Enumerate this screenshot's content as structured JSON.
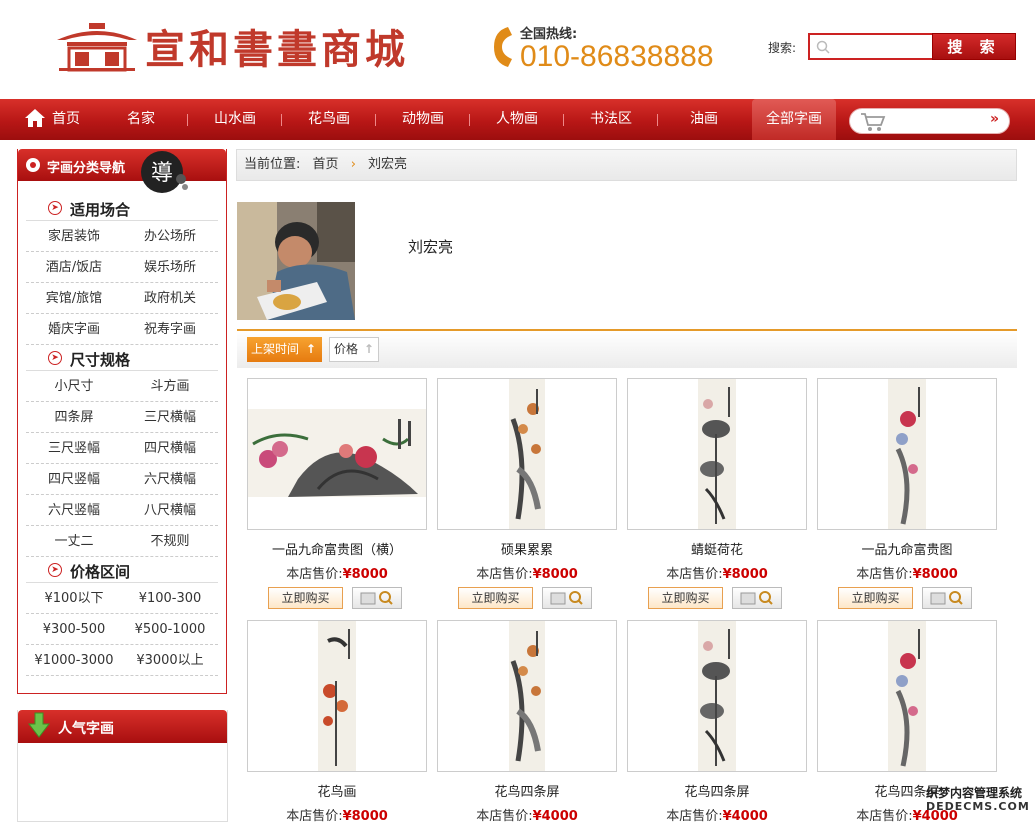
{
  "header": {
    "logo_text": "宣和書畫商城",
    "hotline_label": "全国热线:",
    "hotline_number": "010-86838888",
    "search_label": "搜索:",
    "search_placeholder": "",
    "search_button": "搜 索"
  },
  "nav": {
    "items": [
      "首页",
      "名家",
      "山水画",
      "花鸟画",
      "动物画",
      "人物画",
      "书法区",
      "油画",
      "全部字画"
    ],
    "active_index": 8
  },
  "sidebar": {
    "title": "字画分类导航",
    "badge": "導",
    "groups": [
      {
        "title": "适用场合",
        "items": [
          "家居装饰",
          "办公场所",
          "酒店/饭店",
          "娱乐场所",
          "宾馆/旅馆",
          "政府机关",
          "婚庆字画",
          "祝寿字画"
        ]
      },
      {
        "title": "尺寸规格",
        "items": [
          "小尺寸",
          "斗方画",
          "四条屏",
          "三尺横幅",
          "三尺竖幅",
          "四尺横幅",
          "四尺竖幅",
          "六尺横幅",
          "六尺竖幅",
          "八尺横幅",
          "一丈二",
          "不规则"
        ]
      },
      {
        "title": "价格区间",
        "items": [
          "¥100以下",
          "¥100-300",
          "¥300-500",
          "¥500-1000",
          "¥1000-3000",
          "¥3000以上"
        ]
      }
    ]
  },
  "popular": {
    "title": "人气字画"
  },
  "breadcrumb": {
    "label": "当前位置:",
    "home": "首页",
    "current": "刘宏亮"
  },
  "artist": {
    "name": "刘宏亮"
  },
  "sort": {
    "time_label": "上架时间",
    "price_label": "价格"
  },
  "price_prefix": "本店售价:",
  "buy_label": "立即购买",
  "products": [
    {
      "name": "一品九命富贵图（横）",
      "price": "¥8000"
    },
    {
      "name": "硕果累累",
      "price": "¥8000"
    },
    {
      "name": "蜻蜓荷花",
      "price": "¥8000"
    },
    {
      "name": "一品九命富贵图",
      "price": "¥8000"
    },
    {
      "name": "花鸟画",
      "price": "¥8000"
    },
    {
      "name": "花鸟四条屏",
      "price": "¥4000"
    },
    {
      "name": "花鸟四条屏",
      "price": "¥4000"
    },
    {
      "name": "花鸟四条屏",
      "price": "¥4000"
    }
  ],
  "watermark": {
    "line1": "织梦内容管理系统",
    "line2": "DEDECMS.COM"
  },
  "colors": {
    "brand_red": "#b81716",
    "accent_orange": "#e67b10",
    "price_red": "#c00"
  }
}
